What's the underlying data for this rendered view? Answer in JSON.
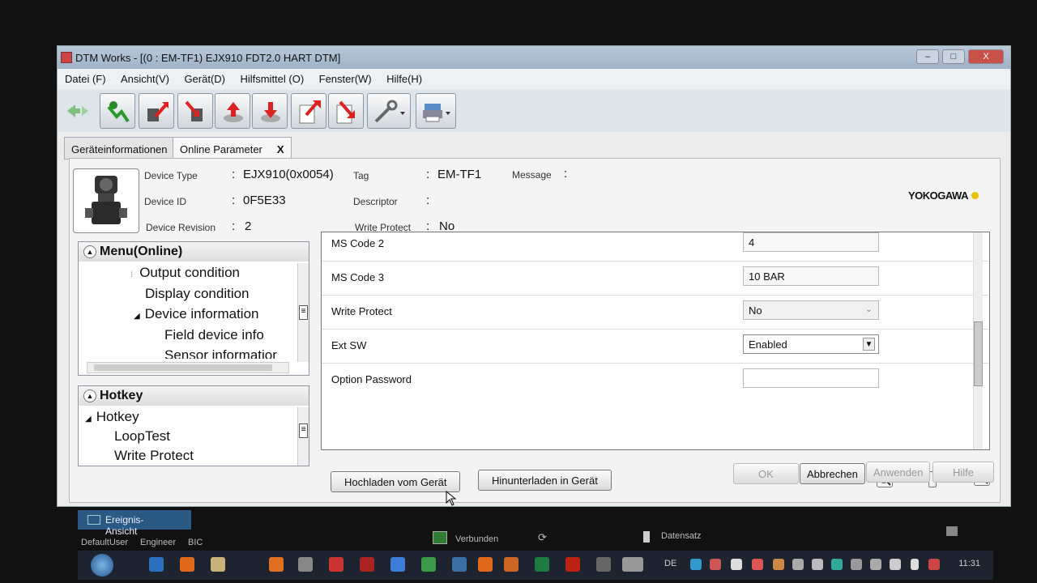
{
  "window": {
    "title": "DTM Works - [(0 : EM-TF1) EJX910 FDT2.0 HART DTM]",
    "controls": {
      "minimize": "‒",
      "maximize": "□",
      "close": "X"
    }
  },
  "menubar": [
    "Datei (F)",
    "Ansicht(V)",
    "Gerät(D)",
    "Hilfsmittel (O)",
    "Fenster(W)",
    "Hilfe(H)"
  ],
  "toolbar_icons": [
    "connect-icon",
    "device-online-icon",
    "device-offline-icon",
    "upload-icon",
    "download-icon",
    "export-icon",
    "import-icon",
    "tools-icon",
    "print-icon"
  ],
  "tabs": {
    "device_info": "Geräteinformationen",
    "online_param": "Online Parameter",
    "close": "X"
  },
  "header": {
    "device_type_label": "Device Type",
    "device_type_value": "EJX910(0x0054)",
    "device_id_label": "Device ID",
    "device_id_value": "0F5E33",
    "device_revision_label": "Device Revision",
    "device_revision_value": "2",
    "tag_label": "Tag",
    "tag_value": "EM-TF1",
    "descriptor_label": "Descriptor",
    "write_protect_label": "Write Protect",
    "write_protect_value": "No",
    "message_label": "Message",
    "colon": ":",
    "logo": "YOKOGAWA"
  },
  "menu_online": {
    "title": "Menu(Online)",
    "items": [
      "Output condition",
      "Display condition",
      "Device information",
      "Field device info",
      "Sensor informatior"
    ]
  },
  "hotkey": {
    "title": "Hotkey",
    "items": [
      "Hotkey",
      "LoopTest",
      "Write Protect"
    ]
  },
  "params": [
    {
      "label": "MS Code 2",
      "value": "4"
    },
    {
      "label": "MS Code 3",
      "value": "10 BAR"
    },
    {
      "label": "Write Protect",
      "value": "No"
    },
    {
      "label": "Ext SW",
      "value": "Enabled"
    },
    {
      "label": "Option Password",
      "value": ""
    }
  ],
  "actions": {
    "upload": "Hochladen vom Gerät",
    "download": "Hinunterladen in Gerät",
    "ok": "OK",
    "cancel": "Abbrechen",
    "apply": "Anwenden",
    "help": "Hilfe"
  },
  "event_view": "Ereignis-Ansicht",
  "status": {
    "user": "DefaultUser",
    "role": "Engineer",
    "bic": "BIC",
    "connection": "Verbunden",
    "dataset": "Datensatz"
  },
  "taskbar": {
    "lang": "DE",
    "clock": "11:31"
  },
  "colors": {
    "accent": "#2a5a83",
    "logo_dot": "#e9c300"
  }
}
